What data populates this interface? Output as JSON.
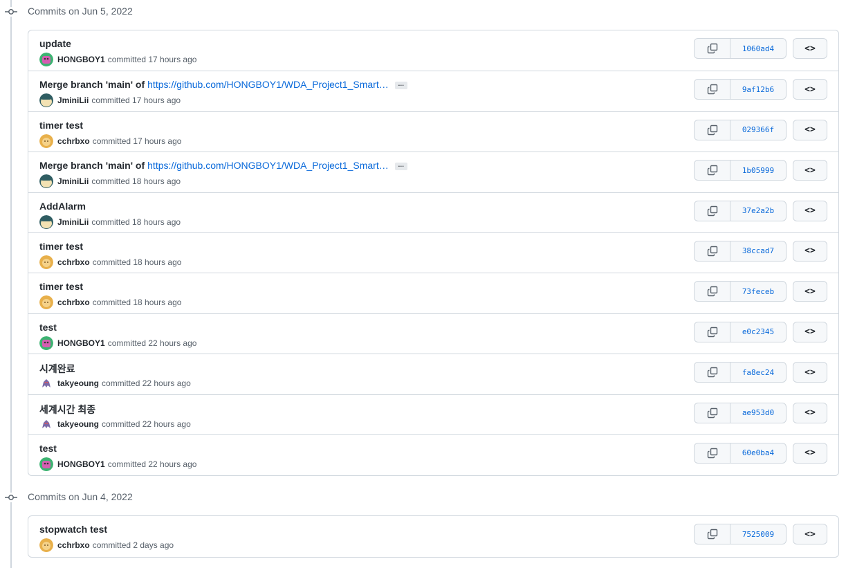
{
  "groups": [
    {
      "title": "Commits on Jun 5, 2022",
      "commits": [
        {
          "message": "update",
          "link": "",
          "author": "HONGBOY1",
          "time": "committed 17 hours ago",
          "sha": "1060ad4",
          "avatar": "green-avatar"
        },
        {
          "message": "Merge branch 'main' of",
          "link": "https://github.com/HONGBOY1/WDA_Project1_Smart…",
          "author": "JminiLii",
          "time": "committed 17 hours ago",
          "sha": "9af12b6",
          "avatar": "snorlax-avatar"
        },
        {
          "message": "timer test",
          "link": "",
          "author": "cchrbxo",
          "time": "committed 17 hours ago",
          "sha": "029366f",
          "avatar": "yellow-avatar"
        },
        {
          "message": "Merge branch 'main' of",
          "link": "https://github.com/HONGBOY1/WDA_Project1_Smart…",
          "author": "JminiLii",
          "time": "committed 18 hours ago",
          "sha": "1b05999",
          "avatar": "snorlax-avatar"
        },
        {
          "message": "AddAlarm",
          "link": "",
          "author": "JminiLii",
          "time": "committed 18 hours ago",
          "sha": "37e2a2b",
          "avatar": "snorlax-avatar"
        },
        {
          "message": "timer test",
          "link": "",
          "author": "cchrbxo",
          "time": "committed 18 hours ago",
          "sha": "38ccad7",
          "avatar": "yellow-avatar"
        },
        {
          "message": "timer test",
          "link": "",
          "author": "cchrbxo",
          "time": "committed 18 hours ago",
          "sha": "73feceb",
          "avatar": "yellow-avatar"
        },
        {
          "message": "test",
          "link": "",
          "author": "HONGBOY1",
          "time": "committed 22 hours ago",
          "sha": "e0c2345",
          "avatar": "green-avatar"
        },
        {
          "message": "시계완료",
          "link": "",
          "author": "takyeoung",
          "time": "committed 22 hours ago",
          "sha": "fa8ec24",
          "avatar": "ghost-avatar"
        },
        {
          "message": "세계시간 최종",
          "link": "",
          "author": "takyeoung",
          "time": "committed 22 hours ago",
          "sha": "ae953d0",
          "avatar": "ghost-avatar"
        },
        {
          "message": "test",
          "link": "",
          "author": "HONGBOY1",
          "time": "committed 22 hours ago",
          "sha": "60e0ba4",
          "avatar": "green-avatar"
        }
      ]
    },
    {
      "title": "Commits on Jun 4, 2022",
      "commits": [
        {
          "message": "stopwatch test",
          "link": "",
          "author": "cchrbxo",
          "time": "committed 2 days ago",
          "sha": "7525009",
          "avatar": "yellow-avatar"
        }
      ]
    }
  ],
  "icons": {
    "commit_node": "git-commit-icon",
    "copy": "copy-icon",
    "browse": "code-icon",
    "ellipsis": "ellipsis-icon"
  },
  "browse_label": "<>",
  "ellipsis_label": "…",
  "colors": {
    "link": "#0969da",
    "muted": "#57606a",
    "border": "#d0d7de",
    "button_bg": "#f6f8fa"
  }
}
